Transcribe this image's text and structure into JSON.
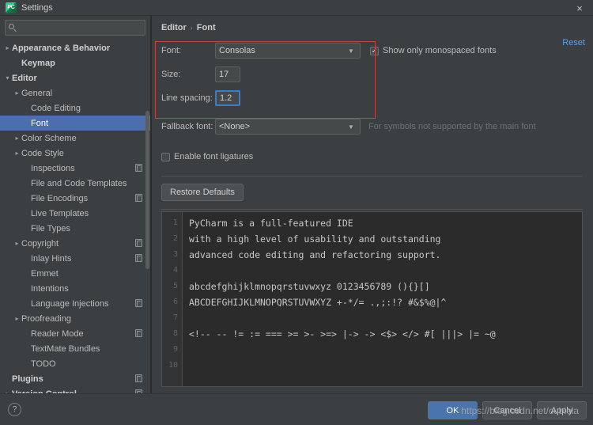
{
  "window": {
    "title": "Settings",
    "app_icon": "pycharm-icon",
    "app_icon_text": "PC",
    "close_icon": "×"
  },
  "search": {
    "value": "",
    "placeholder": "",
    "icon": "search-icon"
  },
  "sidebar": {
    "items": [
      {
        "label": "Appearance & Behavior",
        "indent": 0,
        "arrow": "closed",
        "bold": true,
        "selected": false,
        "badge": false
      },
      {
        "label": "Keymap",
        "indent": 1,
        "arrow": "none",
        "bold": true,
        "selected": false,
        "badge": false
      },
      {
        "label": "Editor",
        "indent": 0,
        "arrow": "open",
        "bold": true,
        "selected": false,
        "badge": false
      },
      {
        "label": "General",
        "indent": 1,
        "arrow": "closed",
        "bold": false,
        "selected": false,
        "badge": false
      },
      {
        "label": "Code Editing",
        "indent": 2,
        "arrow": "none",
        "bold": false,
        "selected": false,
        "badge": false
      },
      {
        "label": "Font",
        "indent": 2,
        "arrow": "none",
        "bold": false,
        "selected": true,
        "badge": false
      },
      {
        "label": "Color Scheme",
        "indent": 1,
        "arrow": "closed",
        "bold": false,
        "selected": false,
        "badge": false
      },
      {
        "label": "Code Style",
        "indent": 1,
        "arrow": "closed",
        "bold": false,
        "selected": false,
        "badge": false
      },
      {
        "label": "Inspections",
        "indent": 2,
        "arrow": "none",
        "bold": false,
        "selected": false,
        "badge": true
      },
      {
        "label": "File and Code Templates",
        "indent": 2,
        "arrow": "none",
        "bold": false,
        "selected": false,
        "badge": false
      },
      {
        "label": "File Encodings",
        "indent": 2,
        "arrow": "none",
        "bold": false,
        "selected": false,
        "badge": true
      },
      {
        "label": "Live Templates",
        "indent": 2,
        "arrow": "none",
        "bold": false,
        "selected": false,
        "badge": false
      },
      {
        "label": "File Types",
        "indent": 2,
        "arrow": "none",
        "bold": false,
        "selected": false,
        "badge": false
      },
      {
        "label": "Copyright",
        "indent": 1,
        "arrow": "closed",
        "bold": false,
        "selected": false,
        "badge": true
      },
      {
        "label": "Inlay Hints",
        "indent": 2,
        "arrow": "none",
        "bold": false,
        "selected": false,
        "badge": true
      },
      {
        "label": "Emmet",
        "indent": 2,
        "arrow": "none",
        "bold": false,
        "selected": false,
        "badge": false
      },
      {
        "label": "Intentions",
        "indent": 2,
        "arrow": "none",
        "bold": false,
        "selected": false,
        "badge": false
      },
      {
        "label": "Language Injections",
        "indent": 2,
        "arrow": "none",
        "bold": false,
        "selected": false,
        "badge": true
      },
      {
        "label": "Proofreading",
        "indent": 1,
        "arrow": "closed",
        "bold": false,
        "selected": false,
        "badge": false
      },
      {
        "label": "Reader Mode",
        "indent": 2,
        "arrow": "none",
        "bold": false,
        "selected": false,
        "badge": true
      },
      {
        "label": "TextMate Bundles",
        "indent": 2,
        "arrow": "none",
        "bold": false,
        "selected": false,
        "badge": false
      },
      {
        "label": "TODO",
        "indent": 2,
        "arrow": "none",
        "bold": false,
        "selected": false,
        "badge": false
      },
      {
        "label": "Plugins",
        "indent": 0,
        "arrow": "none",
        "bold": true,
        "selected": false,
        "badge": true
      },
      {
        "label": "Version Control",
        "indent": 0,
        "arrow": "closed",
        "bold": true,
        "selected": false,
        "badge": true
      }
    ]
  },
  "breadcrumb": {
    "parent": "Editor",
    "separator": "›",
    "current": "Font"
  },
  "reset_link": "Reset",
  "font_settings": {
    "font_label": "Font:",
    "font_value": "Consolas",
    "size_label": "Size:",
    "size_value": "17",
    "line_spacing_label": "Line spacing:",
    "line_spacing_value": "1.2",
    "monospaced_label": "Show only monospaced fonts",
    "monospaced_checked": true,
    "fallback_label": "Fallback font:",
    "fallback_value": "<None>",
    "fallback_hint": "For symbols not supported by the main font",
    "ligatures_label": "Enable font ligatures",
    "ligatures_checked": false,
    "restore_defaults_label": "Restore Defaults",
    "highlight_color": "#c4473f",
    "focus_color": "#3d7cc9",
    "selection_color": "#4b6eaf",
    "link_color": "#589df6"
  },
  "preview": {
    "line_numbers": [
      "1",
      "2",
      "3",
      "4",
      "5",
      "6",
      "7",
      "8",
      "9",
      "10"
    ],
    "lines": [
      "PyCharm is a full-featured IDE",
      "with a high level of usability and outstanding",
      "advanced code editing and refactoring support.",
      "",
      "abcdefghijklmnopqrstuvwxyz 0123456789 (){}[]",
      "ABCDEFGHIJKLMNOPQRSTUVWXYZ +-*/= .,;:!? #&$%@|^",
      "",
      "<!-- -- != := === >= >- >=> |-> -> <$> </> #[ |||> |= ~@",
      "",
      ""
    ],
    "background": "#2b2b2b",
    "gutter_background": "#313335"
  },
  "footer": {
    "help_label": "?",
    "ok_label": "OK",
    "cancel_label": "Cancel",
    "apply_label": "Apply",
    "watermark": "https://blog.csdn.net/cubiela"
  }
}
